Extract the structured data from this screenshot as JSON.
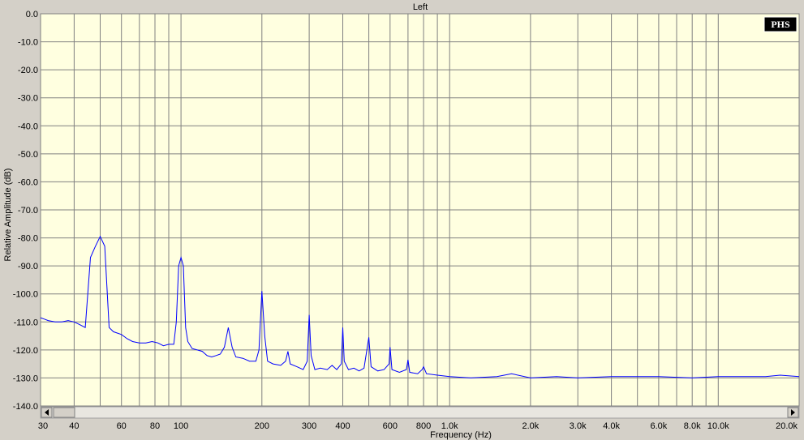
{
  "chart_data": {
    "type": "line",
    "title": "Left",
    "xlabel": "Frequency (Hz)",
    "ylabel": "Relative Amplitude (dB)",
    "x_scale": "log",
    "xlim": [
      30,
      20000
    ],
    "ylim": [
      -140,
      0
    ],
    "grid": true,
    "logo_text": "PHS",
    "y_ticks": [
      "0.0",
      "-10.0",
      "-20.0",
      "-30.0",
      "-40.0",
      "-50.0",
      "-60.0",
      "-70.0",
      "-80.0",
      "-90.0",
      "-100.0",
      "-110.0",
      "-120.0",
      "-130.0",
      "-140.0"
    ],
    "y_tick_values": [
      0,
      -10,
      -20,
      -30,
      -40,
      -50,
      -60,
      -70,
      -80,
      -90,
      -100,
      -110,
      -120,
      -130,
      -140
    ],
    "x_ticks": [
      {
        "value": 30,
        "label": "30"
      },
      {
        "value": 40,
        "label": "40"
      },
      {
        "value": 60,
        "label": "60"
      },
      {
        "value": 80,
        "label": "80"
      },
      {
        "value": 100,
        "label": "100"
      },
      {
        "value": 200,
        "label": "200"
      },
      {
        "value": 300,
        "label": "300"
      },
      {
        "value": 400,
        "label": "400"
      },
      {
        "value": 600,
        "label": "600"
      },
      {
        "value": 800,
        "label": "800"
      },
      {
        "value": 1000,
        "label": "1.0k"
      },
      {
        "value": 2000,
        "label": "2.0k"
      },
      {
        "value": 3000,
        "label": "3.0k"
      },
      {
        "value": 4000,
        "label": "4.0k"
      },
      {
        "value": 6000,
        "label": "6.0k"
      },
      {
        "value": 8000,
        "label": "8.0k"
      },
      {
        "value": 10000,
        "label": "10.0k"
      },
      {
        "value": 20000,
        "label": "20.0k"
      }
    ],
    "x_gridlines": [
      30,
      40,
      50,
      60,
      70,
      80,
      90,
      100,
      200,
      300,
      400,
      500,
      600,
      700,
      800,
      900,
      1000,
      2000,
      3000,
      4000,
      5000,
      6000,
      7000,
      8000,
      9000,
      10000,
      20000
    ],
    "series": [
      {
        "color": "#0000ff",
        "points": [
          [
            30,
            -108.5
          ],
          [
            31,
            -109
          ],
          [
            32,
            -109.5
          ],
          [
            34,
            -110
          ],
          [
            36,
            -110
          ],
          [
            38,
            -109.5
          ],
          [
            40,
            -110
          ],
          [
            42,
            -111
          ],
          [
            44,
            -112
          ],
          [
            46,
            -87
          ],
          [
            48,
            -83
          ],
          [
            50,
            -79.5
          ],
          [
            52,
            -83
          ],
          [
            54,
            -112
          ],
          [
            56,
            -113.5
          ],
          [
            58,
            -114
          ],
          [
            60,
            -114.5
          ],
          [
            63,
            -116
          ],
          [
            66,
            -117
          ],
          [
            70,
            -117.5
          ],
          [
            74,
            -117.5
          ],
          [
            78,
            -117
          ],
          [
            82,
            -117.5
          ],
          [
            86,
            -118.5
          ],
          [
            90,
            -118
          ],
          [
            94,
            -118
          ],
          [
            96,
            -110
          ],
          [
            98,
            -90
          ],
          [
            100,
            -87
          ],
          [
            102,
            -90
          ],
          [
            104,
            -112
          ],
          [
            106,
            -117
          ],
          [
            110,
            -119.5
          ],
          [
            115,
            -120
          ],
          [
            120,
            -120.5
          ],
          [
            125,
            -122
          ],
          [
            130,
            -122.5
          ],
          [
            135,
            -122
          ],
          [
            140,
            -121.5
          ],
          [
            145,
            -119
          ],
          [
            150,
            -112
          ],
          [
            155,
            -119
          ],
          [
            160,
            -122.5
          ],
          [
            170,
            -123
          ],
          [
            180,
            -124
          ],
          [
            190,
            -124
          ],
          [
            195,
            -120
          ],
          [
            200,
            -99
          ],
          [
            205,
            -115
          ],
          [
            210,
            -124
          ],
          [
            220,
            -125
          ],
          [
            235,
            -125.5
          ],
          [
            245,
            -124
          ],
          [
            250,
            -120.5
          ],
          [
            255,
            -125
          ],
          [
            270,
            -126
          ],
          [
            285,
            -127
          ],
          [
            295,
            -124
          ],
          [
            300,
            -107.5
          ],
          [
            305,
            -122
          ],
          [
            315,
            -127
          ],
          [
            330,
            -126.5
          ],
          [
            350,
            -127
          ],
          [
            365,
            -125.5
          ],
          [
            380,
            -127
          ],
          [
            395,
            -125
          ],
          [
            400,
            -112
          ],
          [
            405,
            -124
          ],
          [
            420,
            -127
          ],
          [
            440,
            -126.5
          ],
          [
            460,
            -127.5
          ],
          [
            480,
            -126.5
          ],
          [
            500,
            -115.5
          ],
          [
            510,
            -126
          ],
          [
            540,
            -127.5
          ],
          [
            570,
            -127
          ],
          [
            595,
            -125
          ],
          [
            600,
            -119
          ],
          [
            610,
            -127
          ],
          [
            650,
            -128
          ],
          [
            690,
            -127
          ],
          [
            700,
            -123.5
          ],
          [
            710,
            -128
          ],
          [
            760,
            -128.5
          ],
          [
            790,
            -127
          ],
          [
            800,
            -126
          ],
          [
            820,
            -128.5
          ],
          [
            900,
            -129
          ],
          [
            1000,
            -129.5
          ],
          [
            1200,
            -130
          ],
          [
            1500,
            -129.5
          ],
          [
            1700,
            -128.5
          ],
          [
            2000,
            -130
          ],
          [
            2500,
            -129.5
          ],
          [
            3000,
            -130
          ],
          [
            4000,
            -129.5
          ],
          [
            5000,
            -129.5
          ],
          [
            6000,
            -129.5
          ],
          [
            8000,
            -130
          ],
          [
            10000,
            -129.5
          ],
          [
            12000,
            -129.5
          ],
          [
            15000,
            -129.5
          ],
          [
            17000,
            -129
          ],
          [
            20000,
            -129.5
          ]
        ]
      }
    ]
  }
}
